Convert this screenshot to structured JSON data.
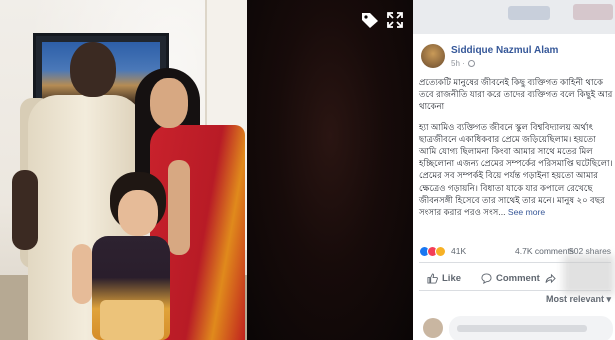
{
  "photo_viewer": {
    "tag_icon": "tag-icon",
    "expand_icon": "expand-icon"
  },
  "post": {
    "author": "Siddique Nazmul Alam",
    "time": "5h",
    "paragraph1": "প্রত্যেকটি মানুষের জীবনেই কিছু ব্যক্তিগত কাহিনী থাকে তবে রাজনীতি যারা করে তাদের ব্যক্তিগত বলে কিছুই আর থাকেনা",
    "paragraph2": "হ্যা আমিও ব্যক্তিগত জীবনে স্কুল বিশ্ববিদ্যালয় অর্থাৎ ছাত্রজীবনে একাধিকবার প্রেমে জড়িয়েছিলাম। হয়তো আমি যোগ্য ছিলামনা কিংবা আমার সাথে মতের মিল হচ্ছিলোনা এজন্য প্রেমের সম্পর্কের পরিসমাপ্তি ঘটেছিলো। প্রেমের সব সম্পর্কই বিয়ে পর্যন্ত গড়াইনা হয়তো আমার ক্ষেত্রেও গড়ায়নি। বিধাতা যাকে যার কপালে রেখেছে জীবনসঙ্গী হিসেবে তার সাথেই তার মনে। মানুষ ২০ বছর সংসার করার পরও সংস...",
    "see_more": "See more",
    "reactions_count": "41K",
    "comments_count": "4.7K comments",
    "shares_count": "502 shares",
    "like_label": "Like",
    "comment_label": "Comment",
    "sort_label": "Most relevant"
  },
  "colors": {
    "link_blue": "#365899",
    "like_blue": "#1877f2",
    "love_red": "#f33e58",
    "haha_yellow": "#f7b125"
  }
}
